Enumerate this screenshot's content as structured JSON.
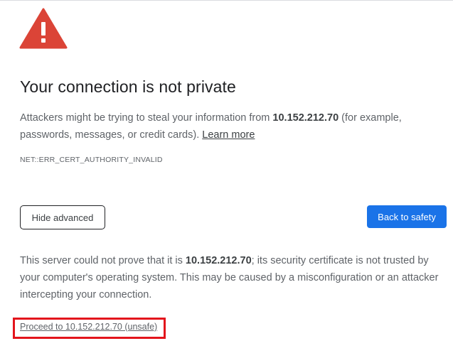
{
  "page": {
    "title": "Your connection is not private",
    "intro": {
      "prefix": "Attackers might be trying to steal your information from ",
      "host": "10.152.212.70",
      "suffix": " (for example, passwords, messages, or credit cards). ",
      "learn_more": "Learn more"
    },
    "error_code": "NET::ERR_CERT_AUTHORITY_INVALID",
    "buttons": {
      "hide_advanced": "Hide advanced",
      "back_to_safety": "Back to safety"
    },
    "details": {
      "prefix": "This server could not prove that it is ",
      "host": "10.152.212.70",
      "suffix": "; its security certificate is not trusted by your computer's operating system. This may be caused by a misconfiguration or an attacker intercepting your connection."
    },
    "proceed_link": "Proceed to 10.152.212.70 (unsafe)"
  },
  "icons": {
    "warning": "warning-triangle-icon"
  },
  "colors": {
    "warning_red": "#db4437",
    "primary_blue": "#1a73e8",
    "highlight_red": "#e3141c"
  }
}
